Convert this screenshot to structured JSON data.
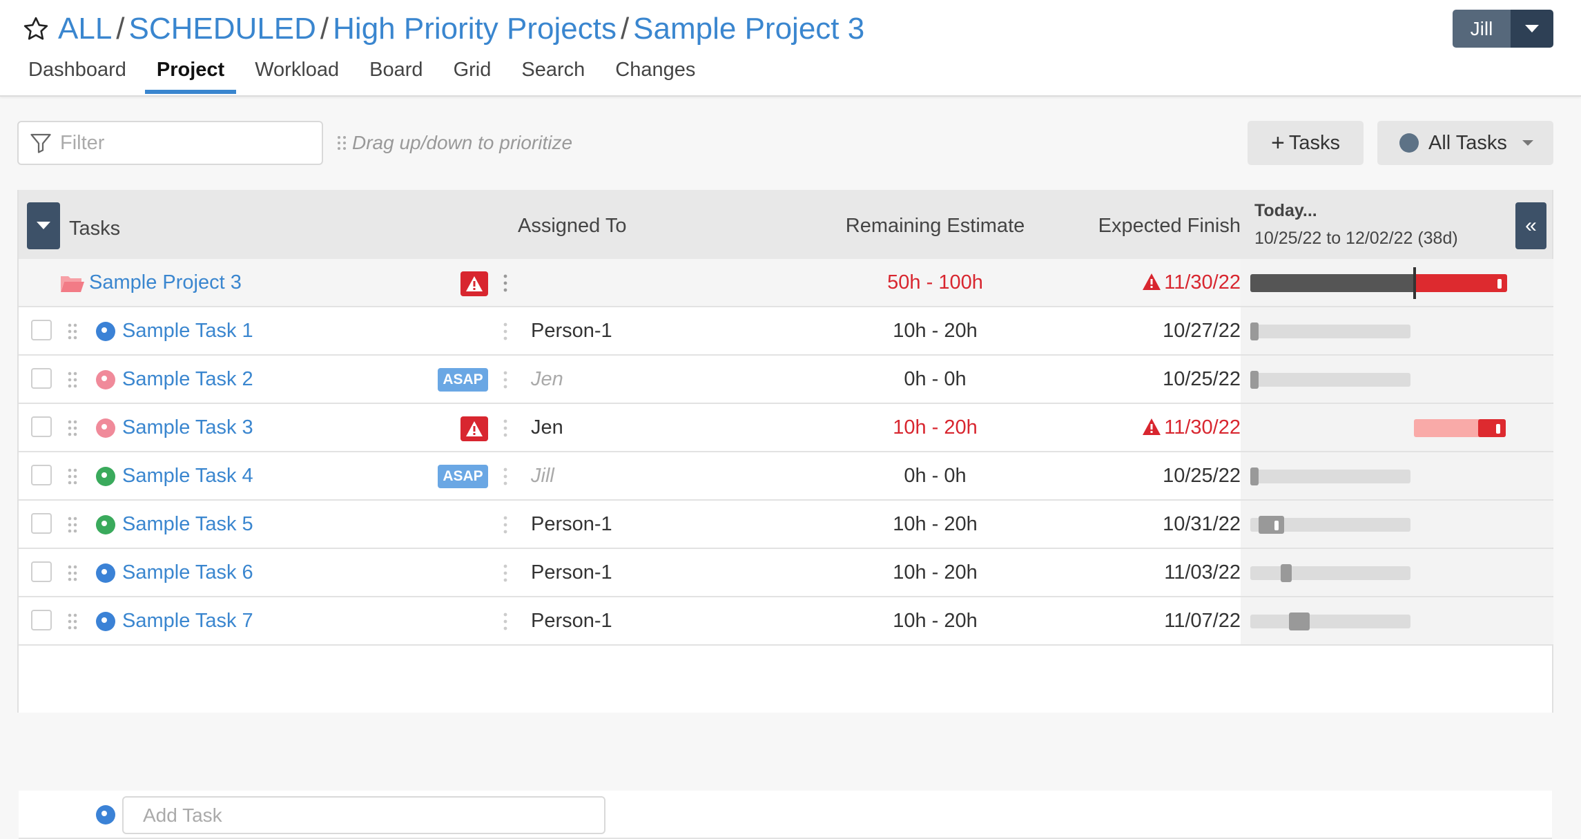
{
  "breadcrumb": [
    "ALL",
    "SCHEDULED",
    "High Priority Projects",
    "Sample Project 3"
  ],
  "breadcrumb_separator": "/",
  "user": {
    "name": "Jill"
  },
  "nav": {
    "tabs": [
      "Dashboard",
      "Project",
      "Workload",
      "Board",
      "Grid",
      "Search",
      "Changes"
    ],
    "active": "Project"
  },
  "toolbar": {
    "filter_placeholder": "Filter",
    "drag_hint": "Drag up/down to prioritize",
    "add_tasks_label": "Tasks",
    "all_tasks_label": "All Tasks"
  },
  "columns": {
    "tasks": "Tasks",
    "assigned": "Assigned To",
    "remaining": "Remaining Estimate",
    "finish": "Expected Finish",
    "today": "Today...",
    "range": "10/25/22 to 12/02/22 (38d)"
  },
  "project": {
    "name": "Sample Project 3",
    "remaining": "50h - 100h",
    "finish": "11/30/22",
    "late": true,
    "gantt": {
      "done_fraction": 0.64,
      "late_fraction": 0.36
    }
  },
  "tasks": [
    {
      "name": "Sample Task 1",
      "status_color": "#3b82d6",
      "badge": "",
      "assigned": "Person-1",
      "assigned_muted": false,
      "remaining": "10h - 20h",
      "finish": "10/27/22",
      "late": false,
      "gantt": {
        "start": 0.0,
        "length": 0.05,
        "style": "gray"
      }
    },
    {
      "name": "Sample Task 2",
      "status_color": "#f08a9a",
      "badge": "ASAP",
      "assigned": "Jen",
      "assigned_muted": true,
      "remaining": "0h - 0h",
      "finish": "10/25/22",
      "late": false,
      "gantt": {
        "start": 0.0,
        "length": 0.02,
        "style": "gray"
      }
    },
    {
      "name": "Sample Task 3",
      "status_color": "#f08a9a",
      "badge": "warning",
      "assigned": "Jen",
      "assigned_muted": false,
      "remaining": "10h - 20h",
      "finish": "11/30/22",
      "late": true,
      "gantt": {
        "start": 0.64,
        "length": 0.36,
        "style": "late"
      }
    },
    {
      "name": "Sample Task 4",
      "status_color": "#3aaa5c",
      "badge": "ASAP",
      "assigned": "Jill",
      "assigned_muted": true,
      "remaining": "0h - 0h",
      "finish": "10/25/22",
      "late": false,
      "gantt": {
        "start": 0.0,
        "length": 0.02,
        "style": "gray"
      }
    },
    {
      "name": "Sample Task 5",
      "status_color": "#3aaa5c",
      "badge": "",
      "assigned": "Person-1",
      "assigned_muted": false,
      "remaining": "10h - 20h",
      "finish": "10/31/22",
      "late": false,
      "gantt": {
        "start": 0.05,
        "length": 0.16,
        "style": "gray"
      }
    },
    {
      "name": "Sample Task 6",
      "status_color": "#3b82d6",
      "badge": "",
      "assigned": "Person-1",
      "assigned_muted": false,
      "remaining": "10h - 20h",
      "finish": "11/03/22",
      "late": false,
      "gantt": {
        "start": 0.19,
        "length": 0.07,
        "style": "gray"
      }
    },
    {
      "name": "Sample Task 7",
      "status_color": "#3b82d6",
      "badge": "",
      "assigned": "Person-1",
      "assigned_muted": false,
      "remaining": "10h - 20h",
      "finish": "11/07/22",
      "late": false,
      "gantt": {
        "start": 0.24,
        "length": 0.13,
        "style": "gray"
      }
    }
  ],
  "add_task_placeholder": "Add Task",
  "colors": {
    "accent": "#3a86cf",
    "danger": "#d8262f",
    "header_dark": "#3d5168",
    "asap": "#6aa7e4"
  },
  "icons": [
    "star-icon",
    "filter-icon",
    "grip-icon",
    "folder-icon",
    "warning-icon",
    "kebab-icon",
    "chevron-down-icon",
    "double-chevron-left-icon"
  ]
}
